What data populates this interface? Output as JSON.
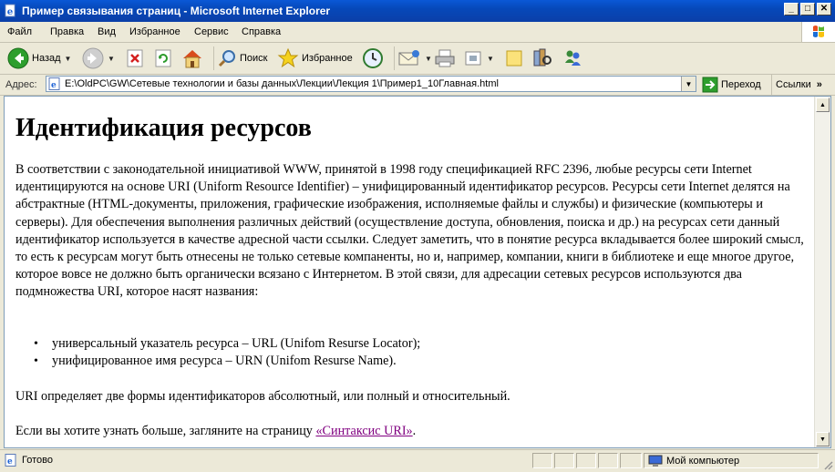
{
  "window": {
    "title": "Пример связывания страниц - Microsoft Internet Explorer",
    "buttons": [
      "minimize",
      "maximize",
      "close"
    ]
  },
  "menu": [
    "Файл",
    "Правка",
    "Вид",
    "Избранное",
    "Сервис",
    "Справка"
  ],
  "toolbar": {
    "back_label": "Назад",
    "search_label": "Поиск",
    "favorites_label": "Избранное"
  },
  "address": {
    "label": "Адрес:",
    "url": "E:\\OldPC\\GW\\Сетевые технологии и базы данных\\Лекции\\Лекция 1\\Пример1_10Главная.html",
    "go_label": "Переход",
    "links_label": "Ссылки"
  },
  "page": {
    "heading": "Идентификация ресурсов",
    "para1": "В соответствии с законодательной инициативой WWW, принятой в 1998 году спецификацией RFC 2396, любые ресурсы сети Internet идентицируются на основе URI (Uniform Resource Identifier) – унифицированный идентификатор ресурсов. Ресурсы сети Internet делятся на абстрактные (HTML-документы, приложения, графические изображения, исполняемые файлы и службы) и физические (компьютеры и серверы). Для обеспечения выполнения различных действий (осуществление доступа, обновления, поиска и др.) на ресурсах сети данный идентификатор используется в качестве адресной части ссылки. Следует заметить, что в понятие ресурса вкладывается более широкий смысл, то есть к ресурсам могут быть отнесены не только сетевые компаненты, но и, например, компании, книги в библиотеке и еще многое другое, которое вовсе не должно быть органически всязано с Интернетом. В этой связи, для адресации сетевых ресурсов используются два подмножества URI, которое насят названия:",
    "list": [
      "универсальный указатель ресурса – URL (Unifom Resurse Locator);",
      "унифицированное имя ресурса – URN (Unifom Resurse Name)."
    ],
    "para2": "URI определяет две формы идентификаторов абсолютный, или полный и относительный.",
    "para3_prefix": "Если вы хотите узнать больше, загляните на страницу ",
    "link_text": "«Синтаксис URI»",
    "para3_suffix": "."
  },
  "status": {
    "text": "Готово",
    "zone": "Мой компьютер"
  },
  "colors": {
    "titlebar": "#0a58d6",
    "chrome": "#ece9d8",
    "visited_link": "#800080"
  }
}
